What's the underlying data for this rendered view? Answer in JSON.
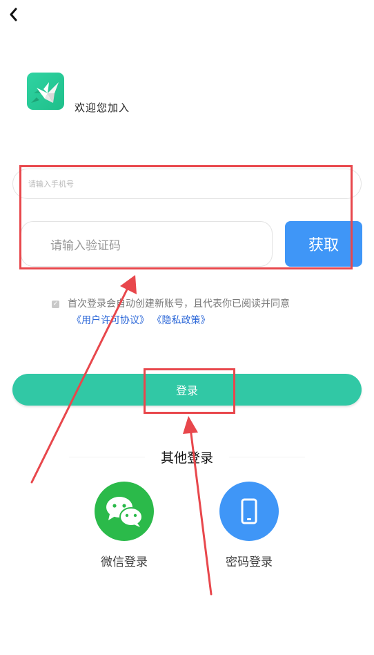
{
  "welcome_text": "欢迎您加入",
  "phone": {
    "placeholder": "请输入手机号",
    "value": ""
  },
  "code": {
    "placeholder": "请输入验证码",
    "value": ""
  },
  "get_code_label": "获取",
  "agreement": {
    "checked": true,
    "text": "首次登录会自动创建新账号，且代表你已阅读并同意",
    "link_user_agreement": "《用户许可协议》",
    "link_privacy_policy": "《隐私政策》"
  },
  "login_label": "登录",
  "other_login": {
    "title": "其他登录",
    "options": [
      {
        "label": "微信登录",
        "icon": "wechat-icon",
        "color": "#2bba4a"
      },
      {
        "label": "密码登录",
        "icon": "phone-icon",
        "color": "#3f96f7"
      }
    ]
  },
  "colors": {
    "brand_green": "#31c8a5",
    "accent_blue": "#3f96f7",
    "annotation_red": "#e8474c",
    "link_blue": "#2b67d8"
  }
}
